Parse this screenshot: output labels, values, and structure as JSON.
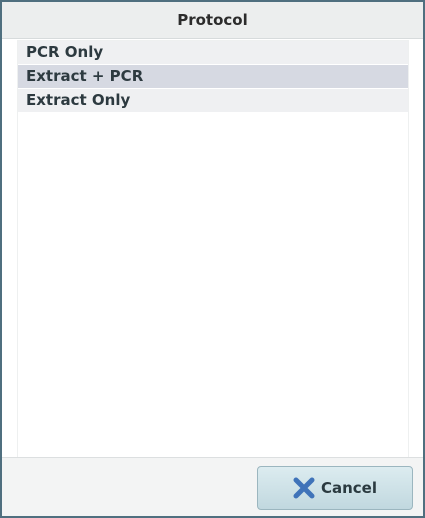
{
  "dialog": {
    "title": "Protocol",
    "items": [
      {
        "label": "PCR Only"
      },
      {
        "label": "Extract + PCR"
      },
      {
        "label": "Extract Only"
      }
    ],
    "cancel_label": "Cancel"
  },
  "icons": {
    "cancel": "close-icon"
  },
  "colors": {
    "frame": "#4f6f7f",
    "selected_row": "#d6d9e2",
    "row": "#eff0f2",
    "cancel_icon": "#3f73b9"
  }
}
